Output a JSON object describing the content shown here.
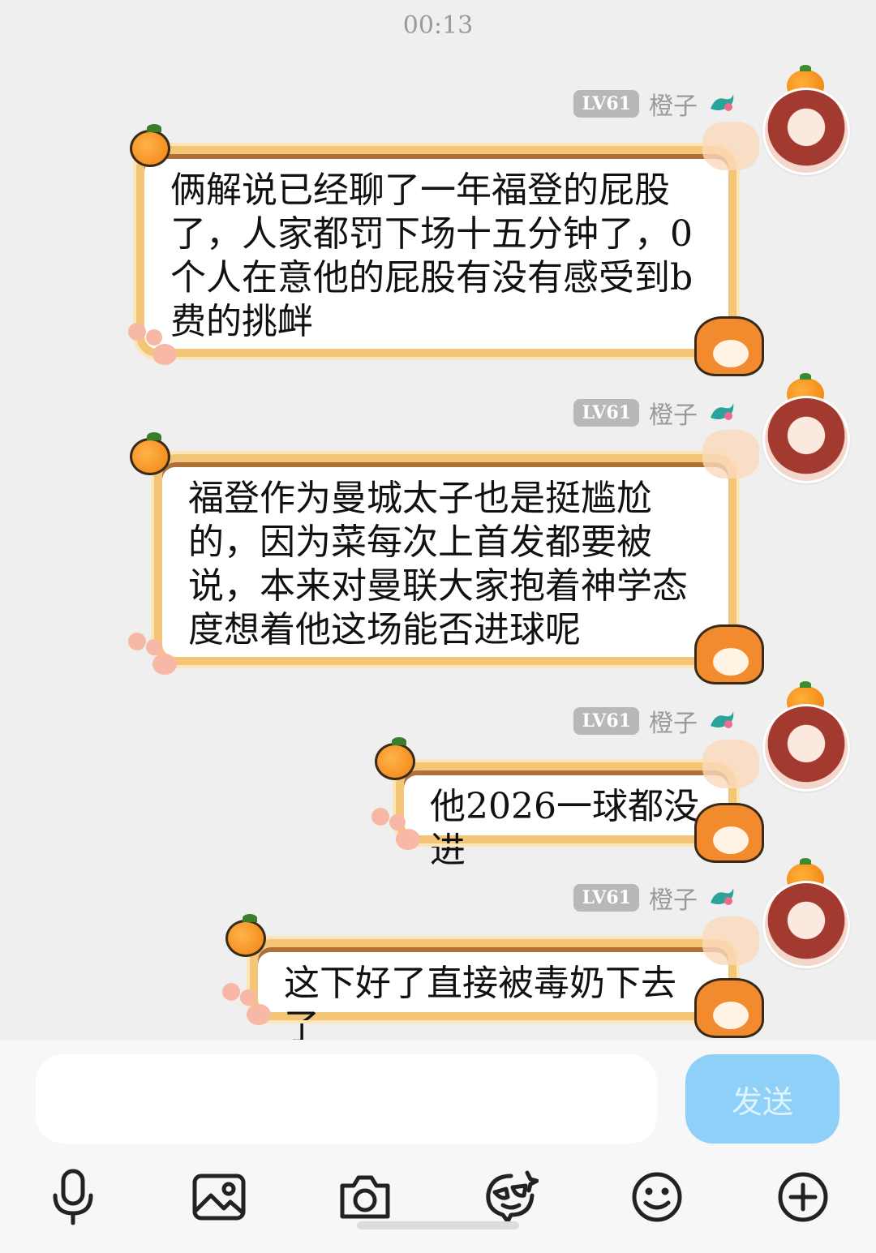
{
  "time": "00:13",
  "user": {
    "level": "LV61",
    "name": "橙子"
  },
  "messages": [
    {
      "text": "俩解说已经聊了一年福登的屁股\n了，人家都罚下场十五分钟了，0\n个人在意他的屁股有没有感受到b\n费的挑衅"
    },
    {
      "text": "福登作为曼城太子也是挺尴尬\n的，因为菜每次上首发都要被\n说，本来对曼联大家抱着神学态\n度想着他这场能否进球呢"
    },
    {
      "text": "他2026一球都没进"
    },
    {
      "text": "这下好了直接被毒奶下去了"
    }
  ],
  "composer": {
    "input_value": "",
    "send_label": "发送"
  },
  "toolbar": [
    "mic-icon",
    "image-icon",
    "camera-icon",
    "sticker-icon",
    "emoji-icon",
    "plus-icon"
  ]
}
